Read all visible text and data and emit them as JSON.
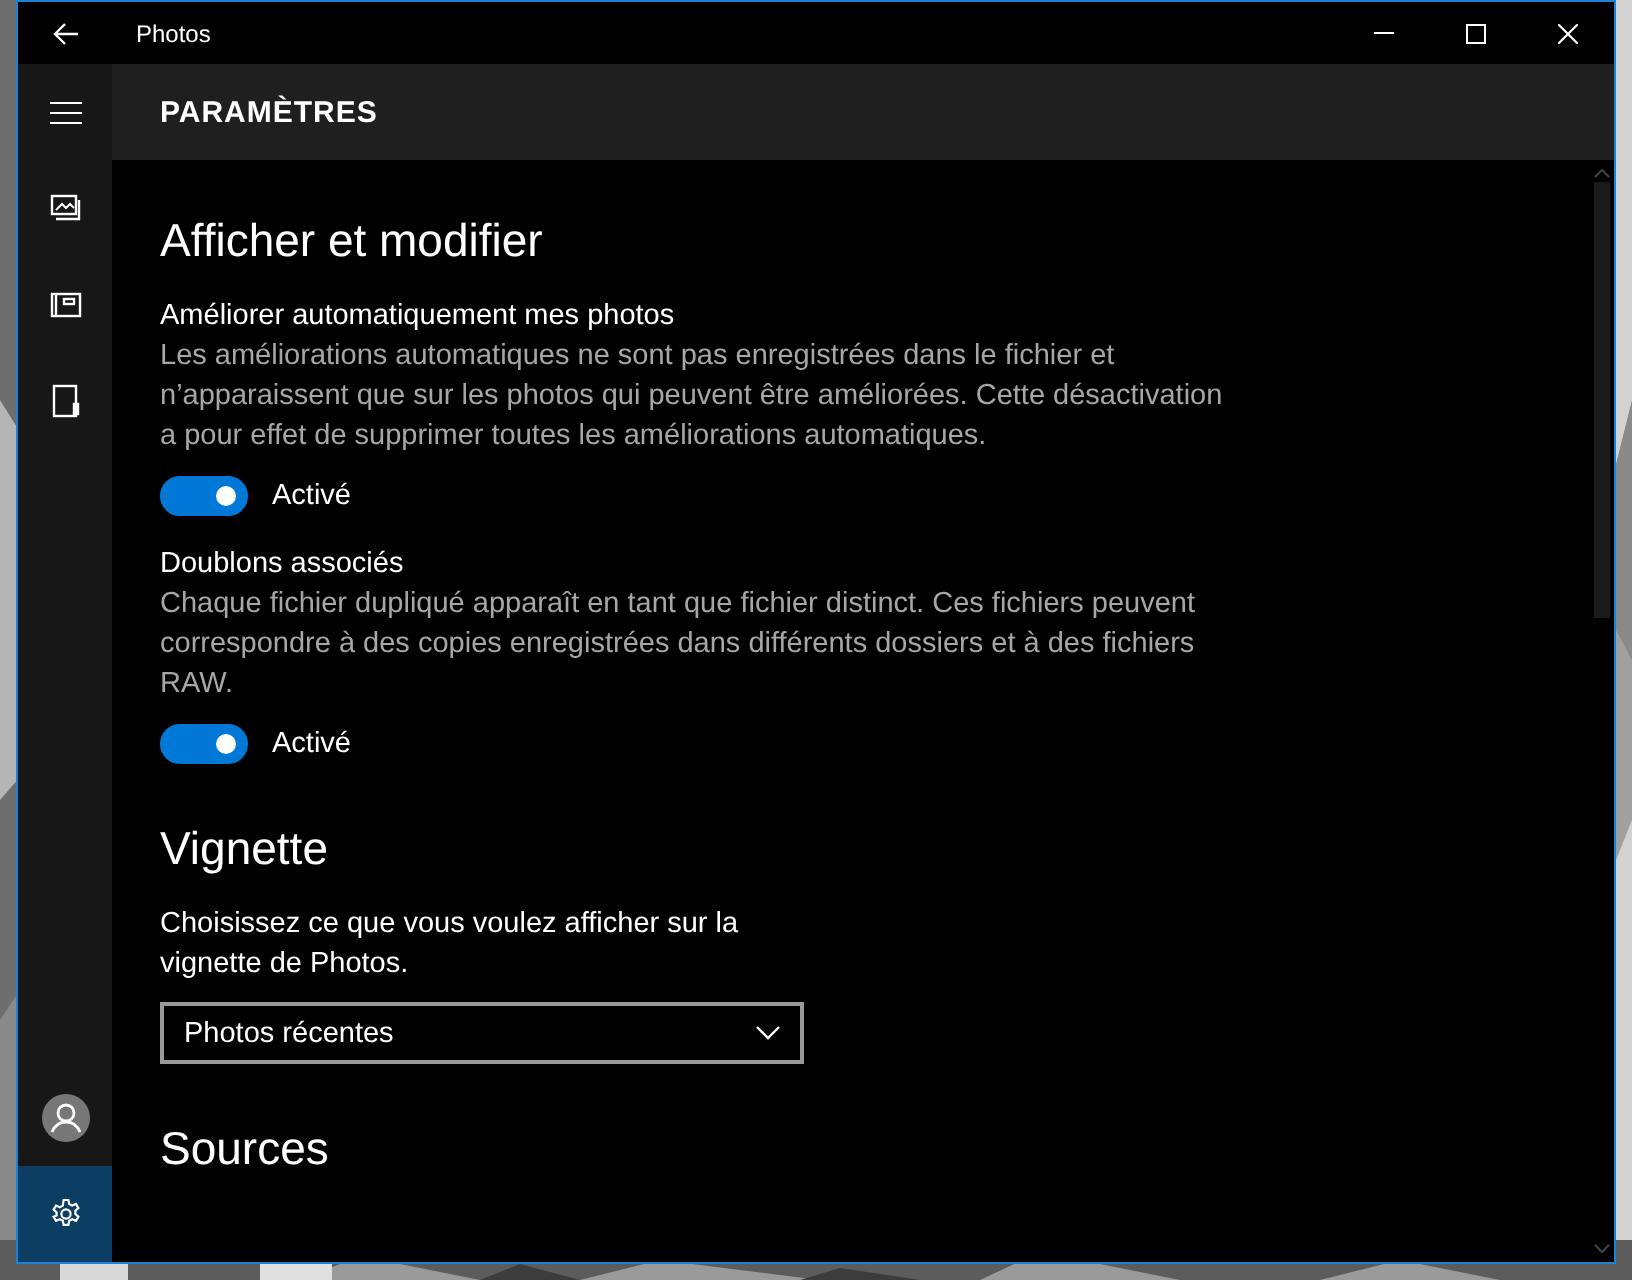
{
  "window": {
    "title": "Photos"
  },
  "sidebar": {
    "items": [
      {
        "kind": "photos",
        "selected": false
      },
      {
        "kind": "album",
        "selected": false
      },
      {
        "kind": "folder",
        "selected": false
      },
      {
        "kind": "account",
        "selected": false
      },
      {
        "kind": "settings",
        "selected": true
      }
    ]
  },
  "header": {
    "title": "PARAMÈTRES"
  },
  "sections": [
    {
      "heading": "Afficher et modifier",
      "settings": [
        {
          "kind": "toggle",
          "title": "Améliorer automatiquement mes photos",
          "description": "Les améliorations automatiques ne sont pas enregistrées dans le fichier et n’apparaissent que sur les photos qui peuvent être améliorées. Cette désactivation a pour effet de supprimer toutes les améliorations automatiques.",
          "on": true,
          "state_label": "Activé"
        },
        {
          "kind": "toggle",
          "title": "Doublons associés",
          "description": "Chaque fichier dupliqué apparaît en tant que fichier distinct. Ces fichiers peuvent correspondre à des copies enregistrées dans différents dossiers et à des fichiers RAW.",
          "on": true,
          "state_label": "Activé"
        }
      ]
    },
    {
      "heading": "Vignette",
      "settings": [
        {
          "kind": "dropdown",
          "description": "Choisissez ce que vous voulez afficher sur la vignette de Photos.",
          "value": "Photos récentes"
        }
      ]
    },
    {
      "heading": "Sources"
    }
  ]
}
